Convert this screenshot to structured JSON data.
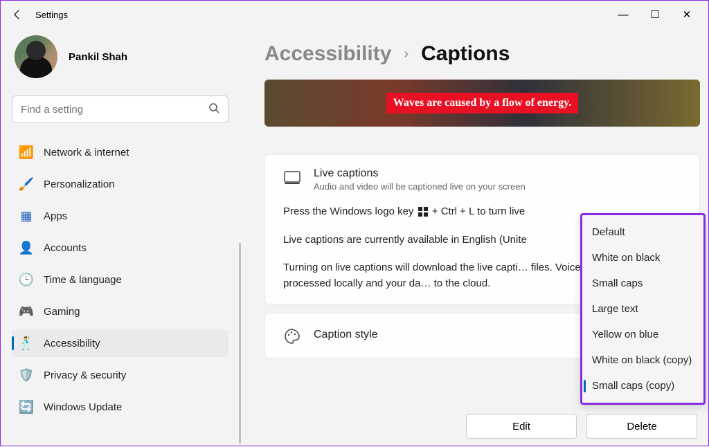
{
  "window": {
    "app_title": "Settings",
    "min": "—",
    "max": "☐",
    "close": "✕"
  },
  "profile": {
    "name": "Pankil Shah"
  },
  "search": {
    "placeholder": "Find a setting"
  },
  "sidebar": {
    "items": [
      {
        "icon": "📶",
        "color": "#0078d4",
        "label": "Network & internet"
      },
      {
        "icon": "🖌️",
        "color": "#c85a2e",
        "label": "Personalization"
      },
      {
        "icon": "▦",
        "color": "#2060c0",
        "label": "Apps"
      },
      {
        "icon": "👤",
        "color": "#2aa060",
        "label": "Accounts"
      },
      {
        "icon": "🕒",
        "color": "#2a80c0",
        "label": "Time & language"
      },
      {
        "icon": "🎮",
        "color": "#888",
        "label": "Gaming"
      },
      {
        "icon": "🕺",
        "color": "#0067c0",
        "label": "Accessibility"
      },
      {
        "icon": "🛡️",
        "color": "#888",
        "label": "Privacy & security"
      },
      {
        "icon": "🔄",
        "color": "#0067c0",
        "label": "Windows Update"
      }
    ],
    "active_index": 6
  },
  "breadcrumb": {
    "parent": "Accessibility",
    "current": "Captions"
  },
  "preview": {
    "caption_text": "Waves are caused by a flow of energy."
  },
  "live_captions": {
    "title": "Live captions",
    "desc": "Audio and video will be captioned live on your screen",
    "shortcut_pre": "Press the Windows logo key ",
    "shortcut_post": " + Ctrl + L to turn live",
    "availability": "Live captions are currently available in English (Unite",
    "download_info": "Turning on live captions will download the live capti… files. Voice data will be processed locally and your da… to the cloud."
  },
  "caption_style": {
    "title": "Caption style",
    "options": [
      "Default",
      "White on black",
      "Small caps",
      "Large text",
      "Yellow on blue",
      "White on black (copy)",
      "Small caps (copy)"
    ],
    "selected_index": 6,
    "edit": "Edit",
    "delete": "Delete"
  }
}
